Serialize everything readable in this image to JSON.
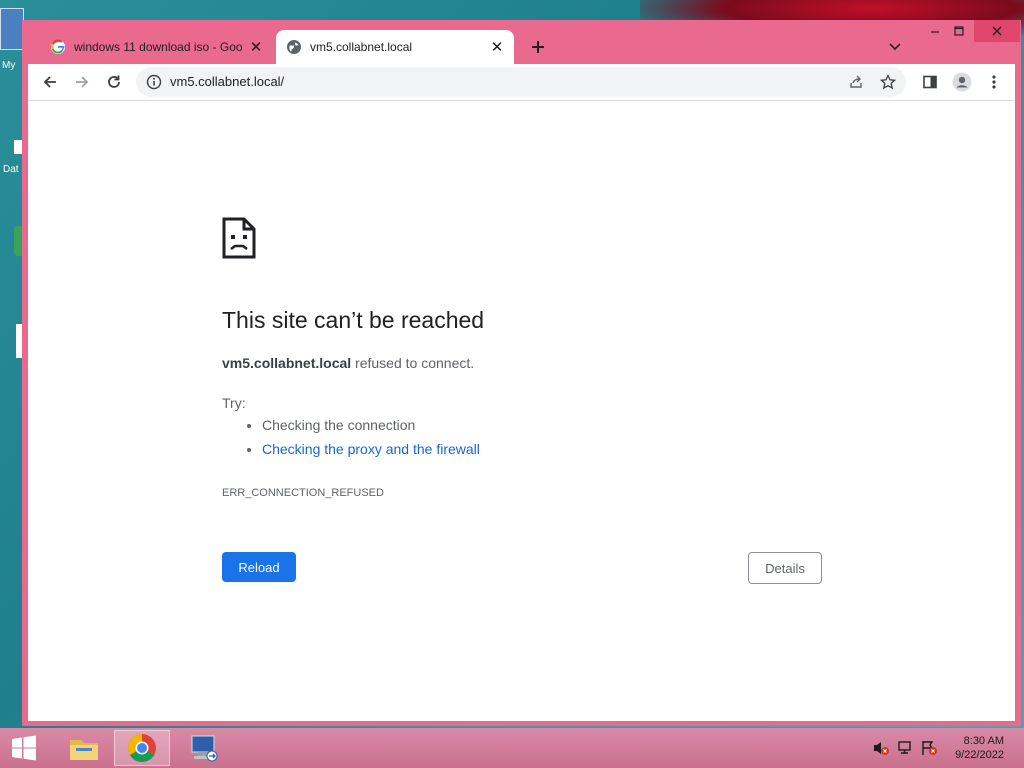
{
  "desktop": {
    "icons": [
      {
        "name": "my-computer",
        "label": "My"
      },
      {
        "name": "data",
        "label": "Dat"
      }
    ]
  },
  "browser": {
    "tabs": [
      {
        "title": "windows 11 download iso - Goo",
        "favicon": "google-icon",
        "active": false
      },
      {
        "title": "vm5.collabnet.local",
        "favicon": "globe-icon",
        "active": true
      }
    ],
    "url": "vm5.collabnet.local/",
    "toolbar_icons": [
      "back-icon",
      "forward-icon",
      "reload-icon",
      "info-icon",
      "share-icon",
      "star-icon",
      "side-panel-icon",
      "profile-icon",
      "menu-icon"
    ]
  },
  "error_page": {
    "icon": "sad-page-icon",
    "title": "This site can’t be reached",
    "host": "vm5.collabnet.local",
    "desc_rest": " refused to connect.",
    "try_label": "Try:",
    "suggestions": [
      "Checking the connection",
      "Checking the proxy and the firewall"
    ],
    "error_code": "ERR_CONNECTION_REFUSED",
    "reload_label": "Reload",
    "details_label": "Details",
    "link_color": "#1967d2",
    "button_color": "#1a73e8"
  },
  "taskbar": {
    "items": [
      "start-icon",
      "file-explorer-icon",
      "chrome-icon",
      "remote-desktop-icon"
    ],
    "time": "8:30 AM",
    "date": "9/22/2022"
  },
  "colors": {
    "window_frame": "#e9698f",
    "desktop": "#2a8f9a"
  }
}
